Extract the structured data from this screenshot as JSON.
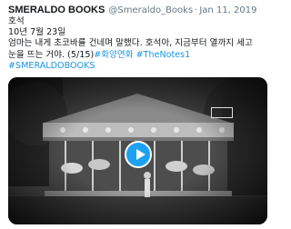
{
  "tweet": {
    "author_name": "SMERALDO BOOKS",
    "handle": "@Smeraldo_Books",
    "separator": "·",
    "date": "Jan 11, 2019",
    "lines": [
      "호석",
      "10년 7월 23일",
      "엄마는 내게 초코바를 건네며 말했다. 호석아, 지금부터 열까지 세고",
      "눈을 뜨는 거야. (5/15)"
    ],
    "hashtags_inline": [
      "#화양연화",
      "#TheNotes1"
    ],
    "hashtag_line": "#SMERALDOBOOKS"
  },
  "media": {
    "type": "video",
    "play_icon": "play-icon"
  },
  "colors": {
    "text": "#14171a",
    "secondary": "#657786",
    "link": "#1b95e0",
    "play": "#1da1f2"
  }
}
